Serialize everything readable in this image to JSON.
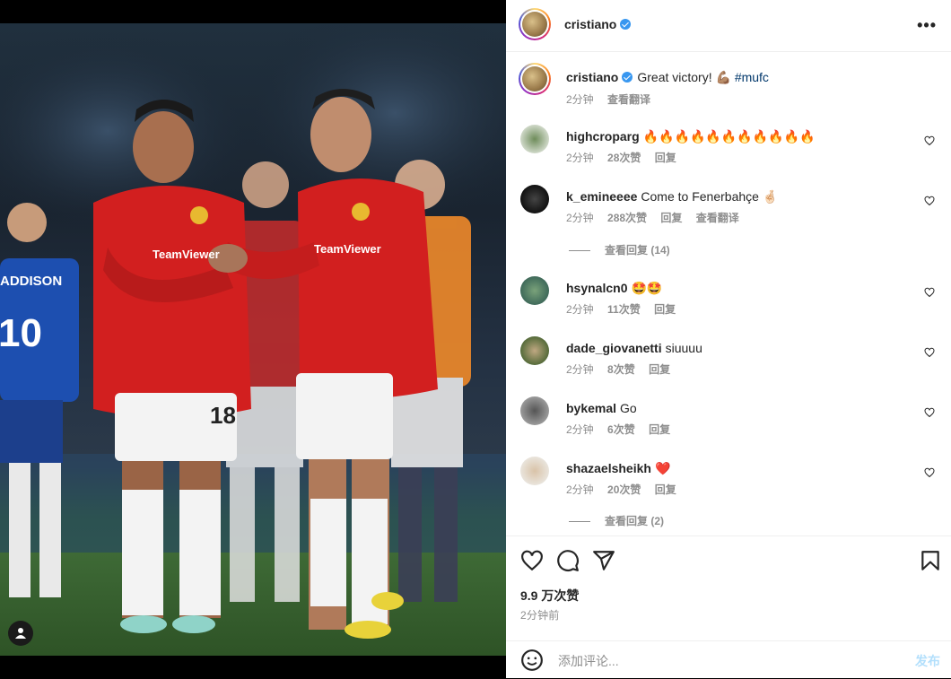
{
  "post": {
    "author": "cristiano",
    "caption_text": "Great victory! 💪🏽",
    "caption_hashtag": "#mufc",
    "caption_time": "2分钟",
    "translate_label": "查看翻译"
  },
  "media": {
    "jersey_left_number": "10",
    "jersey_left_name": "ADDISON",
    "shorts_number": "18",
    "sponsor": "TeamViewer"
  },
  "comments": [
    {
      "user": "highcroparg",
      "text": "🔥🔥🔥🔥🔥🔥🔥🔥🔥🔥🔥",
      "time": "2分钟",
      "likes": "28次赞",
      "reply": "回复",
      "translate": ""
    },
    {
      "user": "k_emineeee",
      "text": "Come to Fenerbahçe 🤞🏻",
      "time": "2分钟",
      "likes": "288次赞",
      "reply": "回复",
      "translate": "查看翻译",
      "view_replies": "查看回复 (14)"
    },
    {
      "user": "hsynalcn0",
      "text": "🤩🤩",
      "time": "2分钟",
      "likes": "11次赞",
      "reply": "回复",
      "translate": ""
    },
    {
      "user": "dade_giovanetti",
      "text": "siuuuu",
      "time": "2分钟",
      "likes": "8次赞",
      "reply": "回复",
      "translate": ""
    },
    {
      "user": "bykemal",
      "text": "Go",
      "time": "2分钟",
      "likes": "6次赞",
      "reply": "回复",
      "translate": ""
    },
    {
      "user": "shazaelsheikh",
      "text": "❤️",
      "time": "2分钟",
      "likes": "20次赞",
      "reply": "回复",
      "translate": "",
      "view_replies": "查看回复 (2)"
    }
  ],
  "stats": {
    "likes": "9.9 万次赞",
    "posted": "2分钟前"
  },
  "composer": {
    "placeholder": "添加评论...",
    "post_label": "发布"
  },
  "icons": {
    "more": "more-options-icon",
    "like": "heart-icon",
    "comment": "comment-icon",
    "share": "share-icon",
    "save": "bookmark-icon",
    "emoji": "emoji-icon",
    "user_tag": "user-tag-icon"
  },
  "colors": {
    "verified": "#3897f0",
    "hashtag": "#00376b",
    "post_button": "#b2dffc",
    "meta_gray": "#8e8e8e",
    "kit_red": "#d21f1f"
  }
}
